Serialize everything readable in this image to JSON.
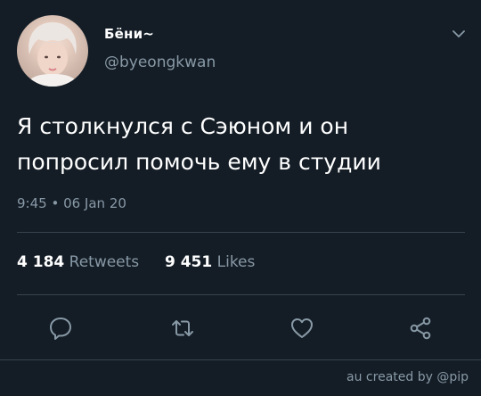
{
  "tweet": {
    "display_name": "Бёни~",
    "handle": "@byeongkwan",
    "text_line1": "Я столкнулся с Сэюном и он",
    "text_line2": "попросил помочь ему в студии",
    "timestamp": "9:45 • 06 Jan 20"
  },
  "stats": {
    "retweets_count": "4 184",
    "retweets_label": "Retweets",
    "likes_count": "9 451",
    "likes_label": "Likes"
  },
  "actions": [
    "reply-icon",
    "retweet-icon",
    "like-icon",
    "share-icon"
  ],
  "footer": {
    "credit": "au created by @pip"
  },
  "colors": {
    "background": "#141d26",
    "secondary_text": "#8899a6",
    "divider": "#38444d"
  }
}
